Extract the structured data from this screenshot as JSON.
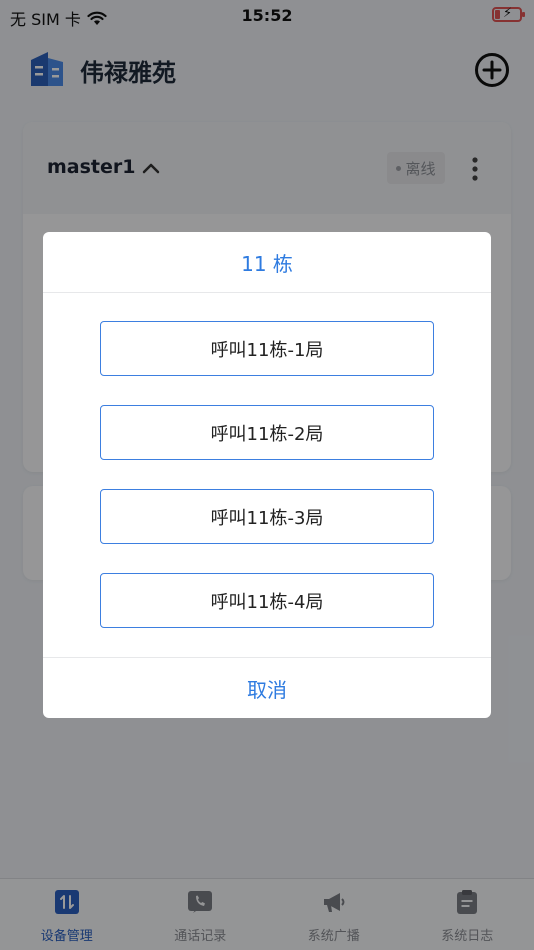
{
  "status_bar": {
    "carrier": "无 SIM 卡",
    "time": "15:52"
  },
  "header": {
    "title": "伟禄雅苑",
    "logo_icon": "building-icon",
    "add_icon": "plus-circle-icon"
  },
  "device": {
    "name": "master1",
    "status": "离线"
  },
  "dialog": {
    "title": "11 栋",
    "options": [
      "呼叫11栋-1局",
      "呼叫11栋-2局",
      "呼叫11栋-3局",
      "呼叫11栋-4局"
    ],
    "cancel": "取消"
  },
  "tabs": [
    {
      "label": "设备管理",
      "icon": "device-manage-icon",
      "active": true
    },
    {
      "label": "通话记录",
      "icon": "phone-icon",
      "active": false
    },
    {
      "label": "系统广播",
      "icon": "megaphone-icon",
      "active": false
    },
    {
      "label": "系统日志",
      "icon": "clipboard-icon",
      "active": false
    }
  ],
  "colors": {
    "accent": "#2e7be0",
    "tab_active": "#2a5fc0",
    "battery": "#e05454"
  }
}
